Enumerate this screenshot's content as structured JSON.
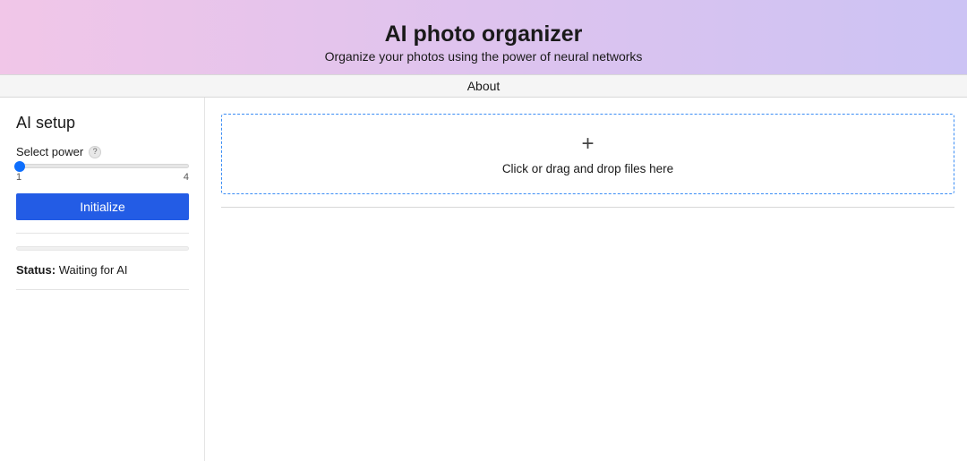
{
  "header": {
    "title": "AI photo organizer",
    "subtitle": "Organize your photos using the power of neural networks"
  },
  "nav": {
    "about_label": "About"
  },
  "sidebar": {
    "heading": "AI setup",
    "power": {
      "label": "Select power",
      "help_symbol": "?",
      "min_label": "1",
      "max_label": "4",
      "value": 1
    },
    "initialize_label": "Initialize",
    "status_label": "Status:",
    "status_value": "Waiting for AI"
  },
  "dropzone": {
    "plus_symbol": "+",
    "text": "Click or drag and drop files here"
  }
}
